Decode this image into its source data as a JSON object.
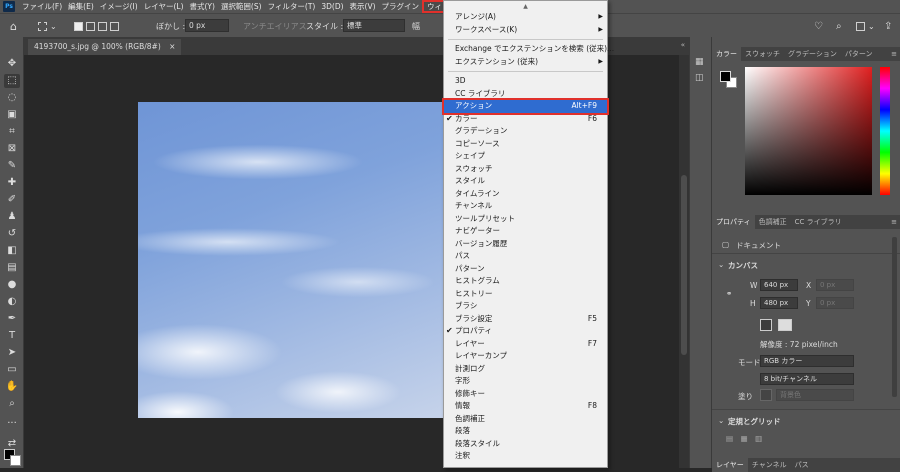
{
  "menubar": {
    "items": [
      "ファイル(F)",
      "編集(E)",
      "イメージ(I)",
      "レイヤー(L)",
      "書式(Y)",
      "選択範囲(S)",
      "フィルター(T)",
      "3D(D)",
      "表示(V)",
      "プラグイン",
      "ウィンドウ(W)"
    ]
  },
  "options": {
    "blur_label": "ぼかし :",
    "blur_value": "0 px",
    "antialias_label": "アンチエイリアス",
    "style_label": "スタイル :",
    "style_value": "標準",
    "width_label": "幅"
  },
  "document": {
    "tab_title": "4193700_s.jpg @ 100% (RGB/8#)",
    "close": "×"
  },
  "window_menu": {
    "top_arrow": "▲",
    "group1": [
      {
        "label": "アレンジ(A)",
        "submenu": true
      },
      {
        "label": "ワークスペース(K)",
        "submenu": true
      }
    ],
    "group2": [
      {
        "label": "Exchange でエクステンションを検索 (従来)..."
      },
      {
        "label": "エクステンション (従来)",
        "submenu": true
      }
    ],
    "group3": [
      {
        "label": "3D",
        "shortcut": "",
        "checked": false
      },
      {
        "label": "CC ライブラリ",
        "shortcut": "",
        "checked": false
      },
      {
        "label": "アクション",
        "shortcut": "Alt+F9",
        "checked": false,
        "highlighted": true
      },
      {
        "label": "カラー",
        "shortcut": "F6",
        "checked": true
      },
      {
        "label": "グラデーション",
        "shortcut": "",
        "checked": false
      },
      {
        "label": "コピーソース",
        "shortcut": "",
        "checked": false
      },
      {
        "label": "シェイプ",
        "shortcut": "",
        "checked": false
      },
      {
        "label": "スウォッチ",
        "shortcut": "",
        "checked": false
      },
      {
        "label": "スタイル",
        "shortcut": "",
        "checked": false
      },
      {
        "label": "タイムライン",
        "shortcut": "",
        "checked": false
      },
      {
        "label": "チャンネル",
        "shortcut": "",
        "checked": false
      },
      {
        "label": "ツールプリセット",
        "shortcut": "",
        "checked": false
      },
      {
        "label": "ナビゲーター",
        "shortcut": "",
        "checked": false
      },
      {
        "label": "バージョン履歴",
        "shortcut": "",
        "checked": false
      },
      {
        "label": "パス",
        "shortcut": "",
        "checked": false
      },
      {
        "label": "パターン",
        "shortcut": "",
        "checked": false
      },
      {
        "label": "ヒストグラム",
        "shortcut": "",
        "checked": false
      },
      {
        "label": "ヒストリー",
        "shortcut": "",
        "checked": false
      },
      {
        "label": "ブラシ",
        "shortcut": "",
        "checked": false
      },
      {
        "label": "ブラシ設定",
        "shortcut": "F5",
        "checked": false
      },
      {
        "label": "プロパティ",
        "shortcut": "",
        "checked": true
      },
      {
        "label": "レイヤー",
        "shortcut": "F7",
        "checked": false
      },
      {
        "label": "レイヤーカンプ",
        "shortcut": "",
        "checked": false
      },
      {
        "label": "計測ログ",
        "shortcut": "",
        "checked": false
      },
      {
        "label": "字形",
        "shortcut": "",
        "checked": false
      },
      {
        "label": "修飾キー",
        "shortcut": "",
        "checked": false
      },
      {
        "label": "情報",
        "shortcut": "F8",
        "checked": false
      },
      {
        "label": "色調補正",
        "shortcut": "",
        "checked": false
      },
      {
        "label": "段落",
        "shortcut": "",
        "checked": false
      },
      {
        "label": "段落スタイル",
        "shortcut": "",
        "checked": false
      },
      {
        "label": "注釈",
        "shortcut": "",
        "checked": false
      }
    ]
  },
  "color_panel": {
    "tabs": [
      "カラー",
      "スウォッチ",
      "グラデーション",
      "パターン"
    ]
  },
  "properties_panel": {
    "tabs": [
      "プロパティ",
      "色調補正",
      "CC ライブラリ"
    ],
    "doc_label": "ドキュメント",
    "canvas_header": "カンバス",
    "w_label": "W",
    "w_value": "640 px",
    "h_label": "H",
    "h_value": "480 px",
    "x_label": "X",
    "x_value": "0 px",
    "y_label": "Y",
    "y_value": "0 px",
    "resolution": "解像度 : 72 pixel/inch",
    "mode_label": "モード",
    "mode_value": "RGB カラー",
    "bit_value": "8 bit/チャンネル",
    "fill_label": "塗り",
    "fill_value": "背景色",
    "guides_header": "定規とグリッド"
  },
  "layers_panel": {
    "tabs": [
      "レイヤー",
      "チャンネル",
      "パス"
    ]
  },
  "colors": {
    "menu_highlight": "#2f6cd0",
    "annotation_red": "#e0302b"
  }
}
